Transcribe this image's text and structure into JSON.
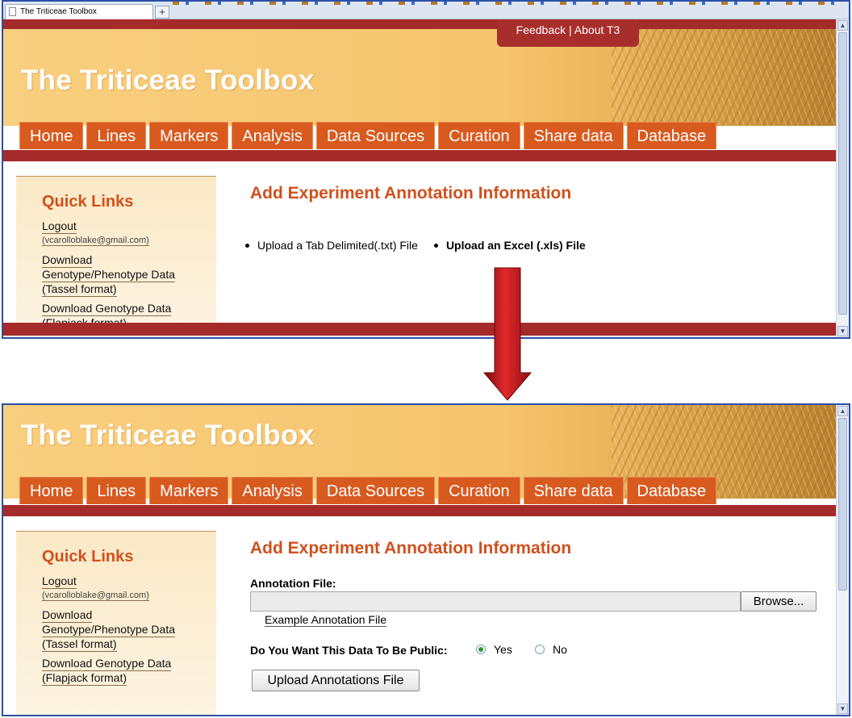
{
  "browser": {
    "tab_title": "The Triticeae Toolbox",
    "new_tab": "+"
  },
  "header": {
    "site_title": "The Triticeae Toolbox",
    "feedback": "Feedback",
    "separator": "|",
    "about": "About T3"
  },
  "nav": [
    "Home",
    "Lines",
    "Markers",
    "Analysis",
    "Data Sources",
    "Curation",
    "Share data",
    "Database"
  ],
  "sidebar": {
    "title": "Quick Links",
    "logout": "Logout",
    "email": "(vcarolloblake@gmail.com)",
    "download_tassel_1": "Download",
    "download_tassel_2": "Genotype/Phenotype Data",
    "download_tassel_3": "(Tassel format)",
    "download_flapjack_1": "Download Genotype Data",
    "download_flapjack_2": "(Flapjack format)"
  },
  "main": {
    "title": "Add Experiment Annotation Information",
    "option_txt": "Upload a Tab Delimited(.txt) File",
    "option_xls": "Upload an Excel (.xls) File"
  },
  "form": {
    "annotation_label": "Annotation File:",
    "browse": "Browse...",
    "example_link": "Example Annotation File",
    "public_label": "Do You Want This Data To Be Public:",
    "yes": "Yes",
    "no": "No",
    "selected": "Yes",
    "upload_button": "Upload Annotations File"
  },
  "colors": {
    "header_red": "#a52a2a",
    "nav_orange": "#d95a1f",
    "title_orange": "#d0501c",
    "arrow_red": "#c0161a"
  }
}
